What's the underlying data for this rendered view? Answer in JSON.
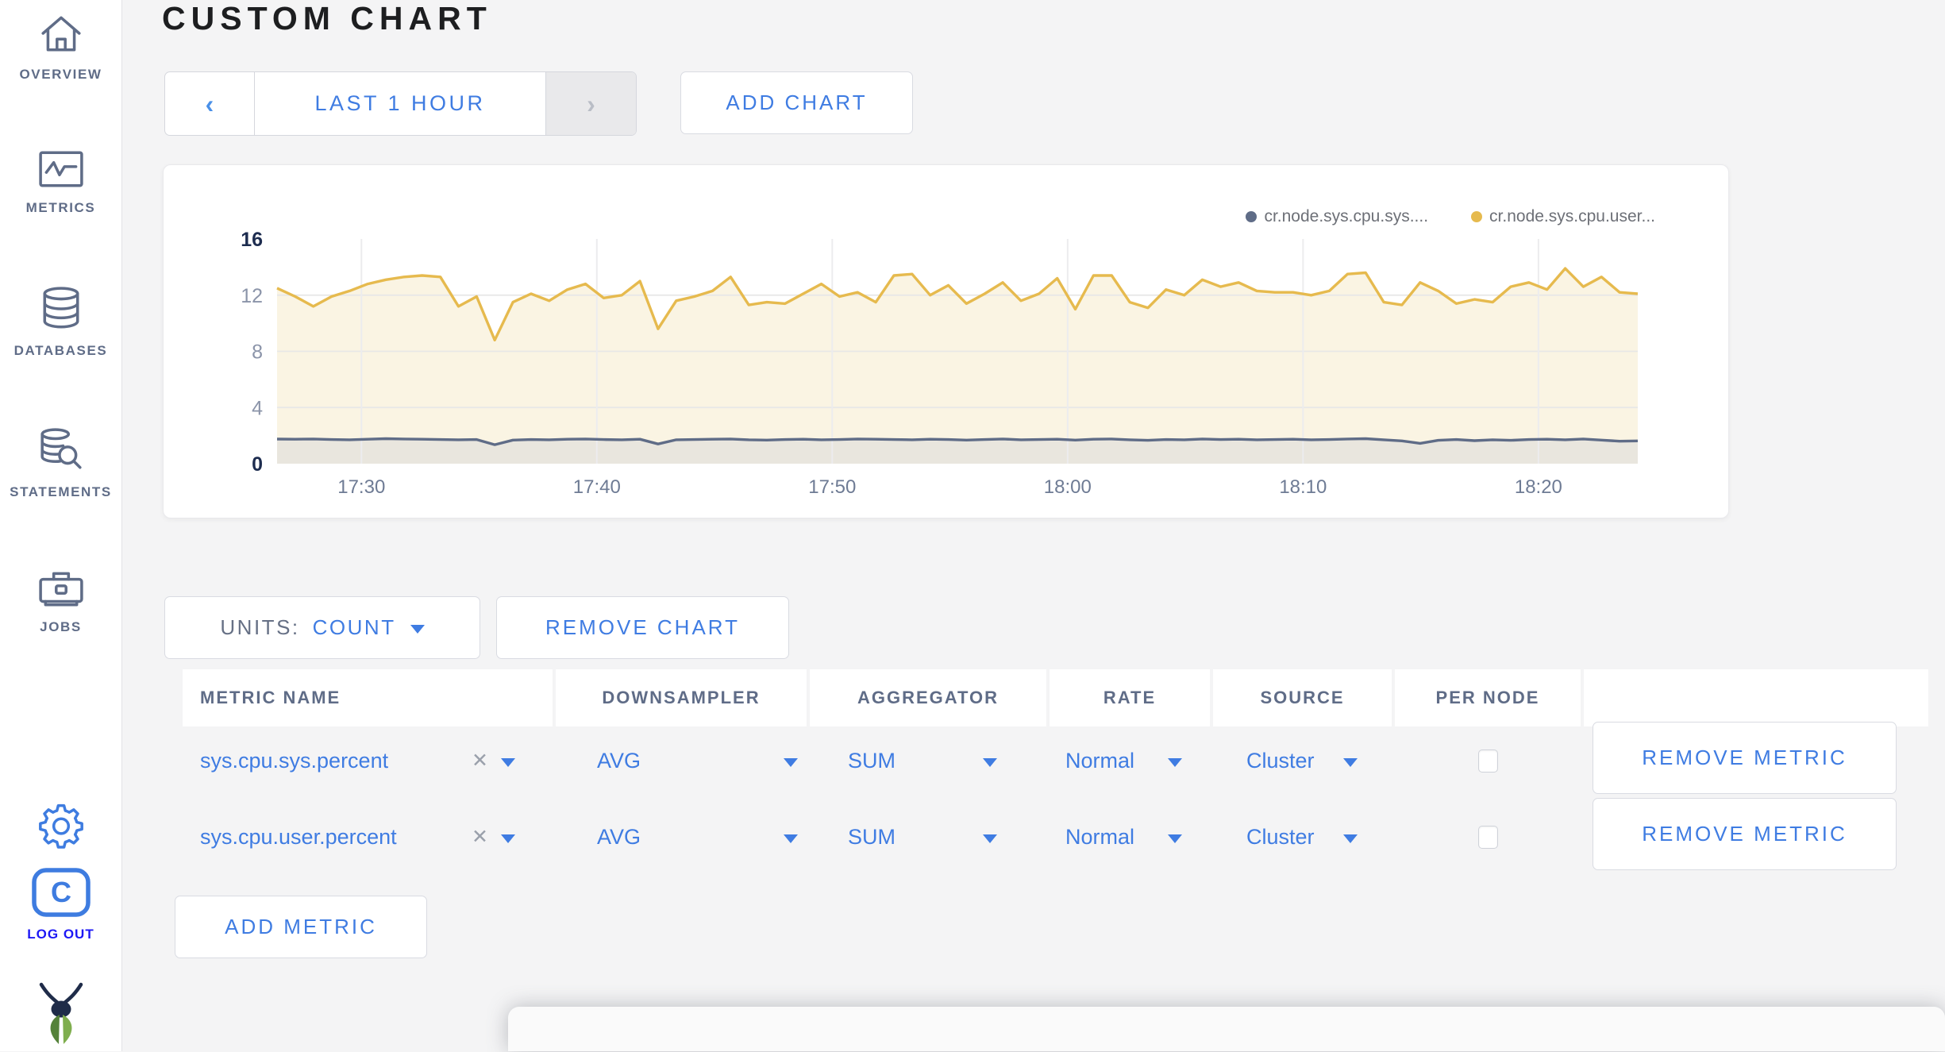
{
  "page_bg": "#f4f4f5",
  "accent_blue": "#3f7ce2",
  "slate": "#5f6c87",
  "sidebar": {
    "items": [
      {
        "label": "OVERVIEW"
      },
      {
        "label": "METRICS"
      },
      {
        "label": "DATABASES"
      },
      {
        "label": "STATEMENTS"
      },
      {
        "label": "JOBS"
      }
    ],
    "logout_label": "LOG OUT"
  },
  "header": {
    "title": "CUSTOM CHART"
  },
  "toolbar": {
    "time_window_label": "LAST 1 HOUR",
    "prev_arrow": "‹",
    "next_arrow": "›",
    "add_chart_label": "ADD CHART"
  },
  "chart": {
    "legend": [
      {
        "label": "cr.node.sys.cpu.sys....",
        "color": "#5f6c87"
      },
      {
        "label": "cr.node.sys.cpu.user...",
        "color": "#e6ba4e"
      }
    ]
  },
  "chart_data": {
    "type": "line",
    "title": "",
    "xlabel": "",
    "ylabel": "",
    "ylim": [
      0,
      16
    ],
    "y_ticks": [
      0,
      4,
      8,
      12,
      16
    ],
    "grid": true,
    "legend_position": "top-right",
    "x_ticks": [
      {
        "label": "17:30",
        "f": 0.062
      },
      {
        "label": "17:40",
        "f": 0.235
      },
      {
        "label": "17:50",
        "f": 0.408
      },
      {
        "label": "18:00",
        "f": 0.581
      },
      {
        "label": "18:10",
        "f": 0.754
      },
      {
        "label": "18:20",
        "f": 0.927
      }
    ],
    "series": [
      {
        "name": "cr.node.sys.cpu.sys....",
        "color": "#5f6c87",
        "fill": "#e9e6de",
        "values": [
          1.75,
          1.74,
          1.76,
          1.72,
          1.7,
          1.74,
          1.78,
          1.76,
          1.74,
          1.72,
          1.7,
          1.72,
          1.35,
          1.68,
          1.72,
          1.7,
          1.74,
          1.76,
          1.72,
          1.7,
          1.74,
          1.4,
          1.7,
          1.72,
          1.74,
          1.76,
          1.7,
          1.68,
          1.72,
          1.74,
          1.7,
          1.72,
          1.76,
          1.74,
          1.72,
          1.7,
          1.74,
          1.72,
          1.68,
          1.72,
          1.76,
          1.7,
          1.72,
          1.74,
          1.68,
          1.74,
          1.76,
          1.7,
          1.66,
          1.72,
          1.7,
          1.76,
          1.72,
          1.74,
          1.7,
          1.72,
          1.74,
          1.7,
          1.72,
          1.76,
          1.78,
          1.7,
          1.62,
          1.45,
          1.66,
          1.72,
          1.64,
          1.7,
          1.66,
          1.72,
          1.74,
          1.7,
          1.76,
          1.68,
          1.6,
          1.62
        ]
      },
      {
        "name": "cr.node.sys.cpu.user...",
        "color": "#e6ba4e",
        "fill": "#faf4e3",
        "values": [
          12.5,
          11.9,
          11.2,
          11.9,
          12.3,
          12.8,
          13.1,
          13.3,
          13.4,
          13.3,
          11.2,
          11.9,
          8.8,
          11.5,
          12.1,
          11.6,
          12.4,
          12.8,
          11.8,
          12.0,
          13.0,
          9.6,
          11.6,
          11.9,
          12.3,
          13.3,
          11.3,
          11.5,
          11.4,
          12.1,
          12.8,
          11.9,
          12.2,
          11.5,
          13.4,
          13.5,
          12.0,
          12.7,
          11.4,
          12.1,
          12.9,
          11.6,
          12.1,
          13.2,
          11.0,
          13.4,
          13.4,
          11.5,
          11.1,
          12.4,
          12.0,
          13.1,
          12.6,
          12.9,
          12.3,
          12.2,
          12.2,
          12.0,
          12.3,
          13.5,
          13.6,
          11.5,
          11.3,
          12.9,
          12.3,
          11.4,
          11.7,
          11.5,
          12.6,
          12.9,
          12.4,
          13.9,
          12.6,
          13.3,
          12.2,
          12.1
        ]
      }
    ]
  },
  "units_bar": {
    "units_label": "UNITS:",
    "units_value": "COUNT",
    "remove_chart_label": "REMOVE CHART"
  },
  "table": {
    "columns": [
      "METRIC NAME",
      "DOWNSAMPLER",
      "AGGREGATOR",
      "RATE",
      "SOURCE",
      "PER NODE",
      ""
    ],
    "rows": [
      {
        "metric": "sys.cpu.sys.percent",
        "downsampler": "AVG",
        "aggregator": "SUM",
        "rate": "Normal",
        "source": "Cluster",
        "per_node_checked": false,
        "remove_label": "REMOVE METRIC"
      },
      {
        "metric": "sys.cpu.user.percent",
        "downsampler": "AVG",
        "aggregator": "SUM",
        "rate": "Normal",
        "source": "Cluster",
        "per_node_checked": false,
        "remove_label": "REMOVE METRIC"
      }
    ],
    "add_metric_label": "ADD METRIC"
  }
}
